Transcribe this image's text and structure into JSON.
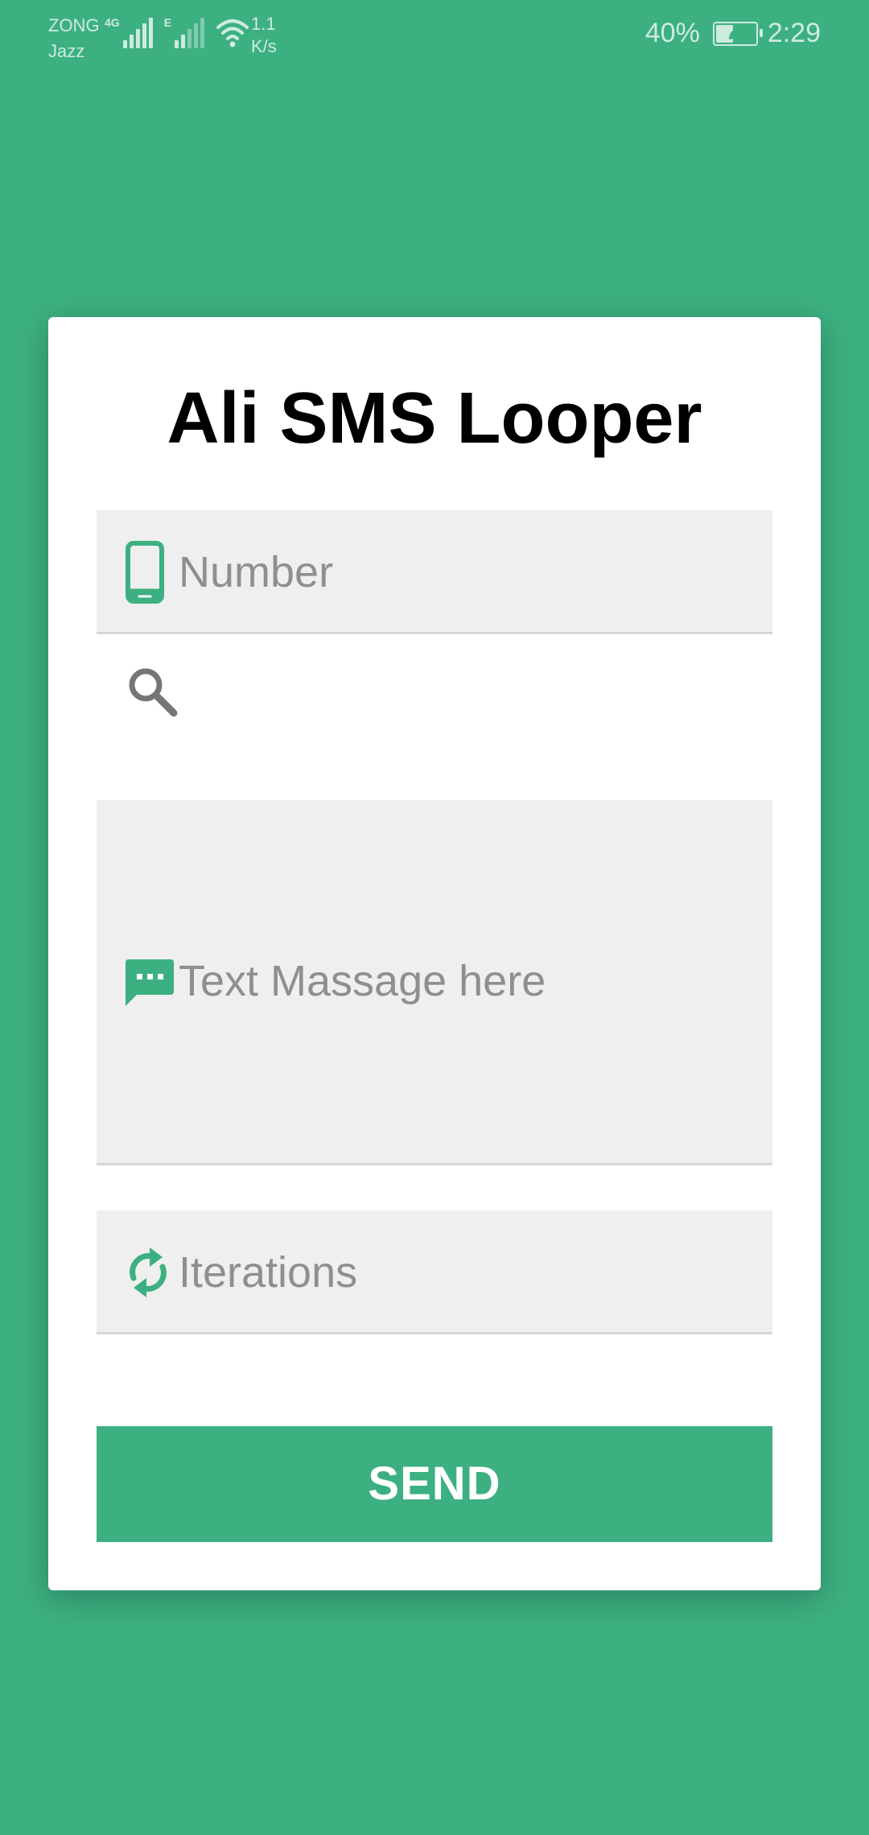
{
  "status_bar": {
    "carrier_1": "ZONG",
    "carrier_2": "Jazz",
    "net_type_1": "4G",
    "net_type_2": "E",
    "speed_value": "1.1",
    "speed_unit": "K/s",
    "battery_percent": "40%",
    "battery_level": 0.4,
    "time": "2:29"
  },
  "app": {
    "title": "Ali SMS Looper",
    "accent_color": "#3cb081"
  },
  "form": {
    "number_placeholder": "Number",
    "number_icon": "phone-icon",
    "search_icon": "search-icon",
    "message_placeholder": "Text Massage here",
    "message_icon": "message-icon",
    "iterations_placeholder": "Iterations",
    "iterations_icon": "refresh-icon",
    "send_label": "SEND"
  }
}
